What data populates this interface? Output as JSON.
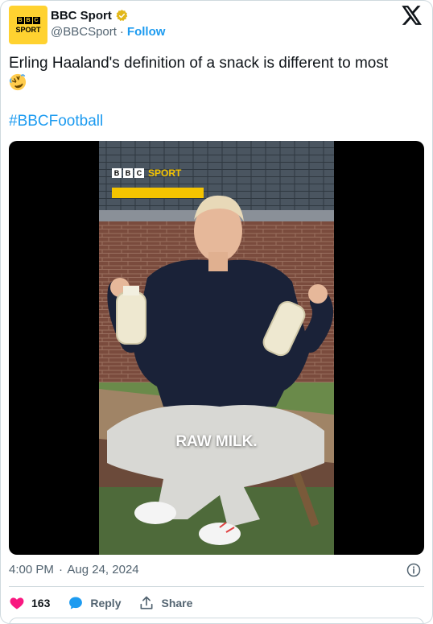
{
  "account": {
    "display_name": "BBC Sport",
    "handle": "@BBCSport",
    "separator": "·",
    "follow_label": "Follow",
    "avatar_letters": [
      "B",
      "B",
      "C"
    ],
    "avatar_word": "SPORT",
    "verified_icon": "verified-gold-badge-icon"
  },
  "tweet": {
    "text": "Erling Haaland's definition of a snack is different to most",
    "emoji_icon": "rolling-on-floor-laughing-emoji-icon",
    "hashtag": "#BBCFootball"
  },
  "media": {
    "watermark_letters": [
      "B",
      "B",
      "C"
    ],
    "watermark_word": "SPORT",
    "caption": "RAW MILK."
  },
  "meta": {
    "time": "4:00 PM",
    "separator": "·",
    "date": "Aug 24, 2024"
  },
  "actions": {
    "like_count": "163",
    "reply_label": "Reply",
    "share_label": "Share"
  },
  "colors": {
    "accent": "#1d9bf0",
    "like": "#f91880",
    "bbc_yellow": "#ffd230"
  }
}
